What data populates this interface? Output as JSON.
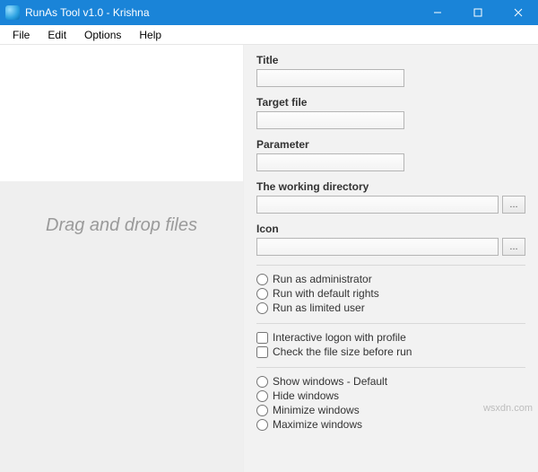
{
  "window": {
    "title": "RunAs Tool v1.0 - Krishna"
  },
  "menu": {
    "file": "File",
    "edit": "Edit",
    "options": "Options",
    "help": "Help"
  },
  "dropzone": {
    "hint": "Drag and drop files"
  },
  "form": {
    "title_label": "Title",
    "title_value": "",
    "target_label": "Target file",
    "target_value": "",
    "param_label": "Parameter",
    "param_value": "",
    "workdir_label": "The working directory",
    "workdir_value": "",
    "icon_label": "Icon",
    "icon_value": "",
    "browse": "..."
  },
  "rights": {
    "admin": "Run as administrator",
    "default": "Run with default rights",
    "limited": "Run as limited user"
  },
  "checks": {
    "interactive": "Interactive logon with profile",
    "filesize": "Check the file size before run"
  },
  "winmode": {
    "show": "Show windows - Default",
    "hide": "Hide windows",
    "min": "Minimize windows",
    "max": "Maximize windows"
  },
  "watermark": "wsxdn.com"
}
